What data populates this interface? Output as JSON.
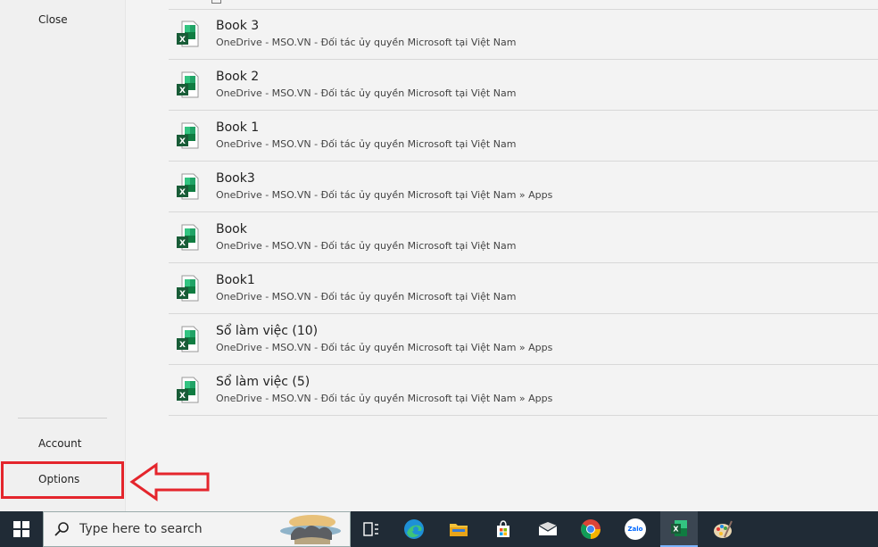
{
  "sidebar": {
    "close_label": "Close",
    "account_label": "Account",
    "options_label": "Options"
  },
  "files": [
    {
      "name": "Book 3",
      "path": "OneDrive - MSO.VN - Đối tác ủy quyền Microsoft tại Việt Nam"
    },
    {
      "name": "Book 2",
      "path": "OneDrive - MSO.VN - Đối tác ủy quyền Microsoft tại Việt Nam"
    },
    {
      "name": "Book 1",
      "path": "OneDrive - MSO.VN - Đối tác ủy quyền Microsoft tại Việt Nam"
    },
    {
      "name": "Book3",
      "path": "OneDrive - MSO.VN - Đối tác ủy quyền Microsoft tại Việt Nam » Apps"
    },
    {
      "name": "Book",
      "path": "OneDrive - MSO.VN - Đối tác ủy quyền Microsoft tại Việt Nam"
    },
    {
      "name": "Book1",
      "path": "OneDrive - MSO.VN - Đối tác ủy quyền Microsoft tại Việt Nam"
    },
    {
      "name": "Sổ làm việc (10)",
      "path": "OneDrive - MSO.VN - Đối tác ủy quyền Microsoft tại Việt Nam » Apps"
    },
    {
      "name": "Sổ làm việc (5)",
      "path": "OneDrive - MSO.VN - Đối tác ủy quyền Microsoft tại Việt Nam » Apps"
    }
  ],
  "taskbar": {
    "search_placeholder": "Type here to search",
    "apps": [
      "start-icon",
      "task-view-icon",
      "edge-icon",
      "file-explorer-icon",
      "store-icon",
      "mail-icon",
      "chrome-icon",
      "zalo-icon",
      "excel-icon",
      "paint-icon"
    ],
    "zalo_text": "Zalo"
  },
  "colors": {
    "excel_green": "#217346",
    "highlight_red": "#e4252c",
    "taskbar_bg": "#202b36"
  }
}
